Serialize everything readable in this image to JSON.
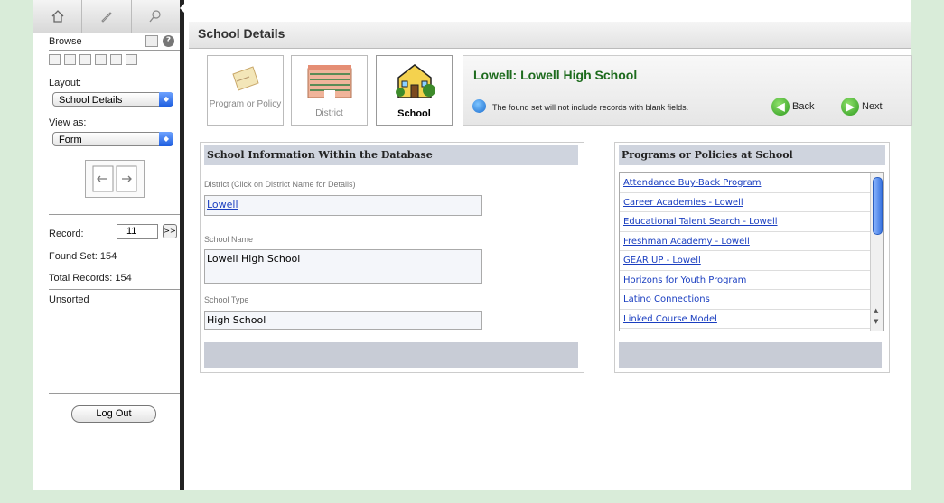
{
  "sidebar": {
    "mode_label": "Browse",
    "layout_label": "Layout:",
    "layout_value": "School Details",
    "view_label": "View as:",
    "view_value": "Form",
    "record_label": "Record:",
    "record_value": "11",
    "found_set": "Found Set: 154",
    "total_records": "Total Records: 154",
    "sort_status": "Unsorted",
    "logout_label": "Log Out"
  },
  "header": {
    "title": "School Details"
  },
  "nav": {
    "program_label": "Program or Policy",
    "district_label": "District",
    "school_label": "School"
  },
  "info": {
    "title": "Lowell: Lowell High School",
    "note": "The found set will not include records with blank fields.",
    "back_label": "Back",
    "next_label": "Next"
  },
  "school_panel": {
    "heading": "School Information Within the Database",
    "district_label": "District (Click on District Name for Details)",
    "district_value": "Lowell",
    "name_label": "School Name",
    "name_value": "Lowell High School",
    "type_label": "School Type",
    "type_value": "High School"
  },
  "programs_panel": {
    "heading": "Programs or Policies at School",
    "items": [
      "Attendance Buy-Back Program",
      "Career Academies - Lowell",
      "Educational Talent Search - Lowell",
      "Freshman Academy - Lowell",
      "GEAR UP - Lowell",
      "Horizons for Youth Program",
      "Latino Connections",
      "Linked Course Model"
    ]
  },
  "colors": {
    "background": "#d9ecd9",
    "title_green": "#1d6b1d",
    "link_blue": "#1a3ec0",
    "panel_header": "#cfd4de"
  }
}
